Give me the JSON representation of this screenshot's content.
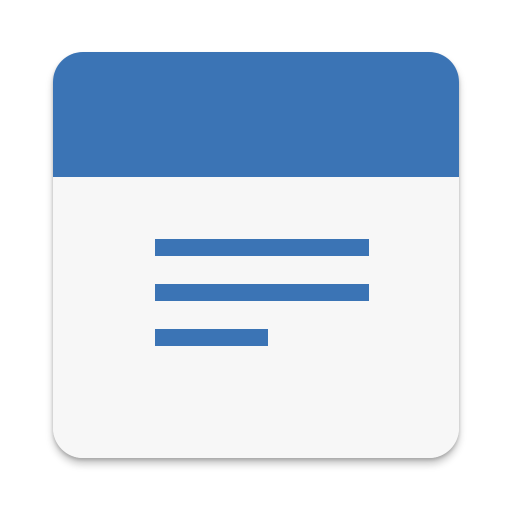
{
  "app_icon": {
    "name": "document-notes-app-icon",
    "icon": "document-lines-icon",
    "colors": {
      "header": "#3b74b5",
      "body": "#f7f7f7",
      "lines": "#3b74b5"
    },
    "text_lines": [
      {
        "fill_fraction": 1.0
      },
      {
        "fill_fraction": 1.0
      },
      {
        "fill_fraction": 0.53
      }
    ]
  }
}
